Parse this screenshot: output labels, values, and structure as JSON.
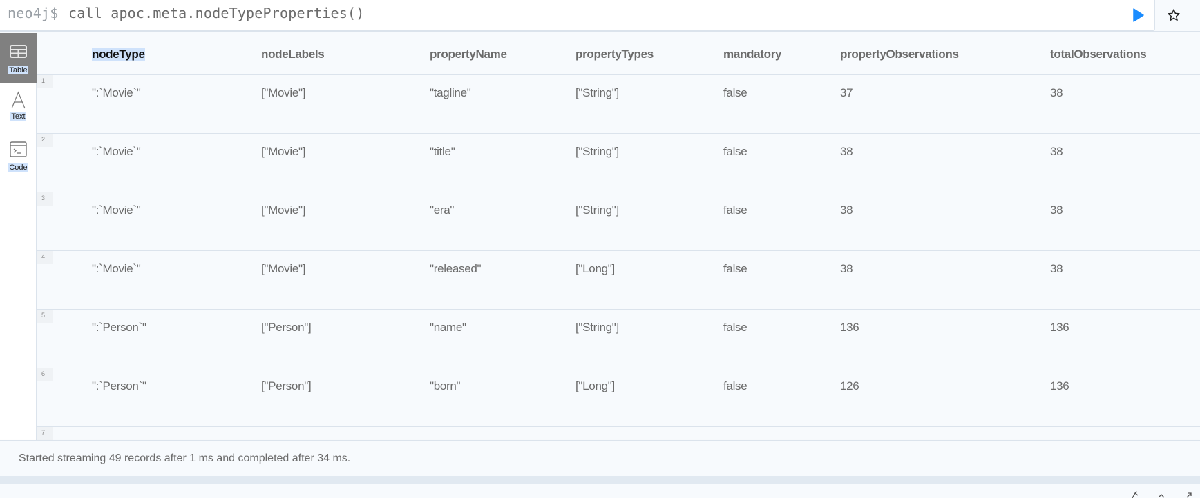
{
  "editor": {
    "prompt": "neo4j$",
    "query": "call apoc.meta.nodeTypeProperties()",
    "play_icon": "play-icon",
    "star_icon": "star-icon",
    "play_color": "#1a8cff"
  },
  "sidebar": {
    "items": [
      {
        "label": "Table",
        "icon": "table-icon",
        "active": true
      },
      {
        "label": "Text",
        "icon": "text-icon",
        "active": false
      },
      {
        "label": "Code",
        "icon": "code-icon",
        "active": false
      }
    ]
  },
  "table": {
    "columns": [
      "nodeType",
      "nodeLabels",
      "propertyName",
      "propertyTypes",
      "mandatory",
      "propertyObservations",
      "totalObservations"
    ],
    "rows": [
      {
        "num": "1",
        "cells": [
          "\":`Movie`\"",
          "[\"Movie\"]",
          "\"tagline\"",
          "[\"String\"]",
          "false",
          "37",
          "38"
        ]
      },
      {
        "num": "2",
        "cells": [
          "\":`Movie`\"",
          "[\"Movie\"]",
          "\"title\"",
          "[\"String\"]",
          "false",
          "38",
          "38"
        ]
      },
      {
        "num": "3",
        "cells": [
          "\":`Movie`\"",
          "[\"Movie\"]",
          "\"era\"",
          "[\"String\"]",
          "false",
          "38",
          "38"
        ]
      },
      {
        "num": "4",
        "cells": [
          "\":`Movie`\"",
          "[\"Movie\"]",
          "\"released\"",
          "[\"Long\"]",
          "false",
          "38",
          "38"
        ]
      },
      {
        "num": "5",
        "cells": [
          "\":`Person`\"",
          "[\"Person\"]",
          "\"name\"",
          "[\"String\"]",
          "false",
          "136",
          "136"
        ]
      },
      {
        "num": "6",
        "cells": [
          "\":`Person`\"",
          "[\"Person\"]",
          "\"born\"",
          "[\"Long\"]",
          "false",
          "126",
          "136"
        ]
      },
      {
        "num": "7",
        "cells": [
          "",
          "",
          "",
          "",
          "",
          "",
          ""
        ]
      }
    ]
  },
  "status": {
    "text": "Started streaming 49 records after 1 ms and completed after 34 ms."
  },
  "footer": {
    "icons": [
      "pin-icon",
      "chevron-up-icon",
      "expand-icon"
    ]
  }
}
